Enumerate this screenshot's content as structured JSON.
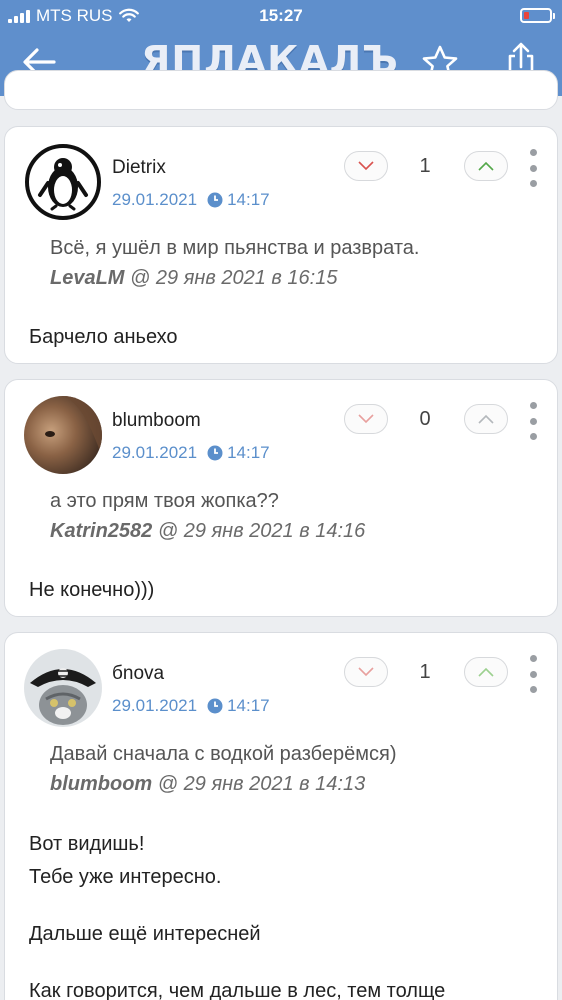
{
  "status_bar": {
    "carrier": "MTS RUS",
    "time": "15:27"
  },
  "header": {
    "logo": "ЯПЛАКАЛЪ"
  },
  "comments": [
    {
      "username": "Dietrix",
      "date": "29.01.2021",
      "time": "14:17",
      "score": "1",
      "quote_text": "Всё, я ушёл в мир пьянства и разврата.",
      "quote_author": "LevaLM",
      "quote_at": " @ 29 янв 2021 в 16:15",
      "body": [
        "Барчело аньехо"
      ]
    },
    {
      "username": "blumboom",
      "date": "29.01.2021",
      "time": "14:17",
      "score": "0",
      "quote_text": "а это прям твоя жопка??",
      "quote_author": "Katrin2582",
      "quote_at": " @ 29 янв 2021 в 14:16",
      "body": [
        "Не конечно)))"
      ]
    },
    {
      "username": "бnova",
      "date": "29.01.2021",
      "time": "14:17",
      "score": "1",
      "quote_text": "Давай сначала с водкой разберёмся)",
      "quote_author": "blumboom",
      "quote_at": " @ 29 янв 2021 в 14:13",
      "body": [
        "Вот видишь!",
        "Тебе уже интересно.",
        "Дальше ещё интересней",
        "Как говорится, чем дальше в лес, тем толще"
      ]
    }
  ],
  "colors": {
    "header": "#5f8fcc",
    "link": "#5b8fcb",
    "upvote": "#54a84a",
    "downvote": "#d9534f"
  }
}
